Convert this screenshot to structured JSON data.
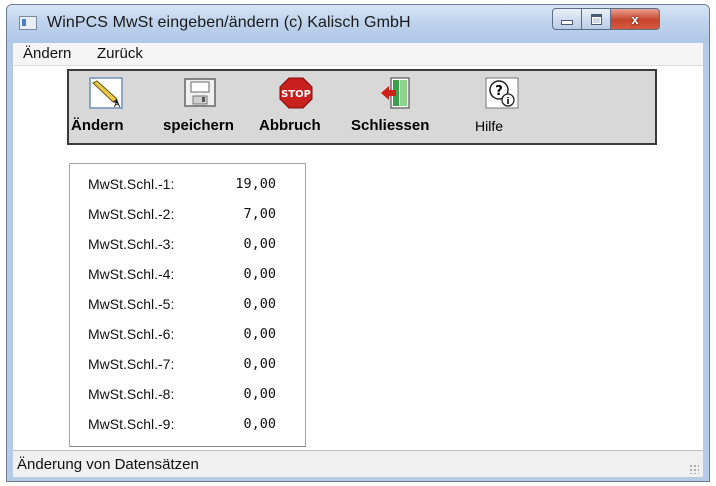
{
  "window": {
    "title": "WinPCS   MwSt eingeben/ändern   (c) Kalisch GmbH",
    "buttons": {
      "minimize": "minimize",
      "maximize": "maximize",
      "close": "x"
    }
  },
  "menu": {
    "items": [
      {
        "label": "Ändern"
      },
      {
        "label": "Zurück"
      }
    ]
  },
  "toolbar": {
    "items": [
      {
        "label": "Ändern",
        "icon": "pencil-edit-icon"
      },
      {
        "label": "speichern",
        "icon": "floppy-disk-icon"
      },
      {
        "label": "Abbruch",
        "icon": "stop-sign-icon",
        "icon_text": "STOP"
      },
      {
        "label": "Schliessen",
        "icon": "exit-door-icon"
      },
      {
        "label": "Hilfe",
        "icon": "help-question-icon"
      }
    ]
  },
  "vat": {
    "rows": [
      {
        "label": "MwSt.Schl.-1:",
        "value": "19,00"
      },
      {
        "label": "MwSt.Schl.-2:",
        "value": "7,00"
      },
      {
        "label": "MwSt.Schl.-3:",
        "value": "0,00"
      },
      {
        "label": "MwSt.Schl.-4:",
        "value": "0,00"
      },
      {
        "label": "MwSt.Schl.-5:",
        "value": "0,00"
      },
      {
        "label": "MwSt.Schl.-6:",
        "value": "0,00"
      },
      {
        "label": "MwSt.Schl.-7:",
        "value": "0,00"
      },
      {
        "label": "MwSt.Schl.-8:",
        "value": "0,00"
      },
      {
        "label": "MwSt.Schl.-9:",
        "value": "0,00"
      }
    ]
  },
  "status": {
    "text": "Änderung von Datensätzen"
  }
}
